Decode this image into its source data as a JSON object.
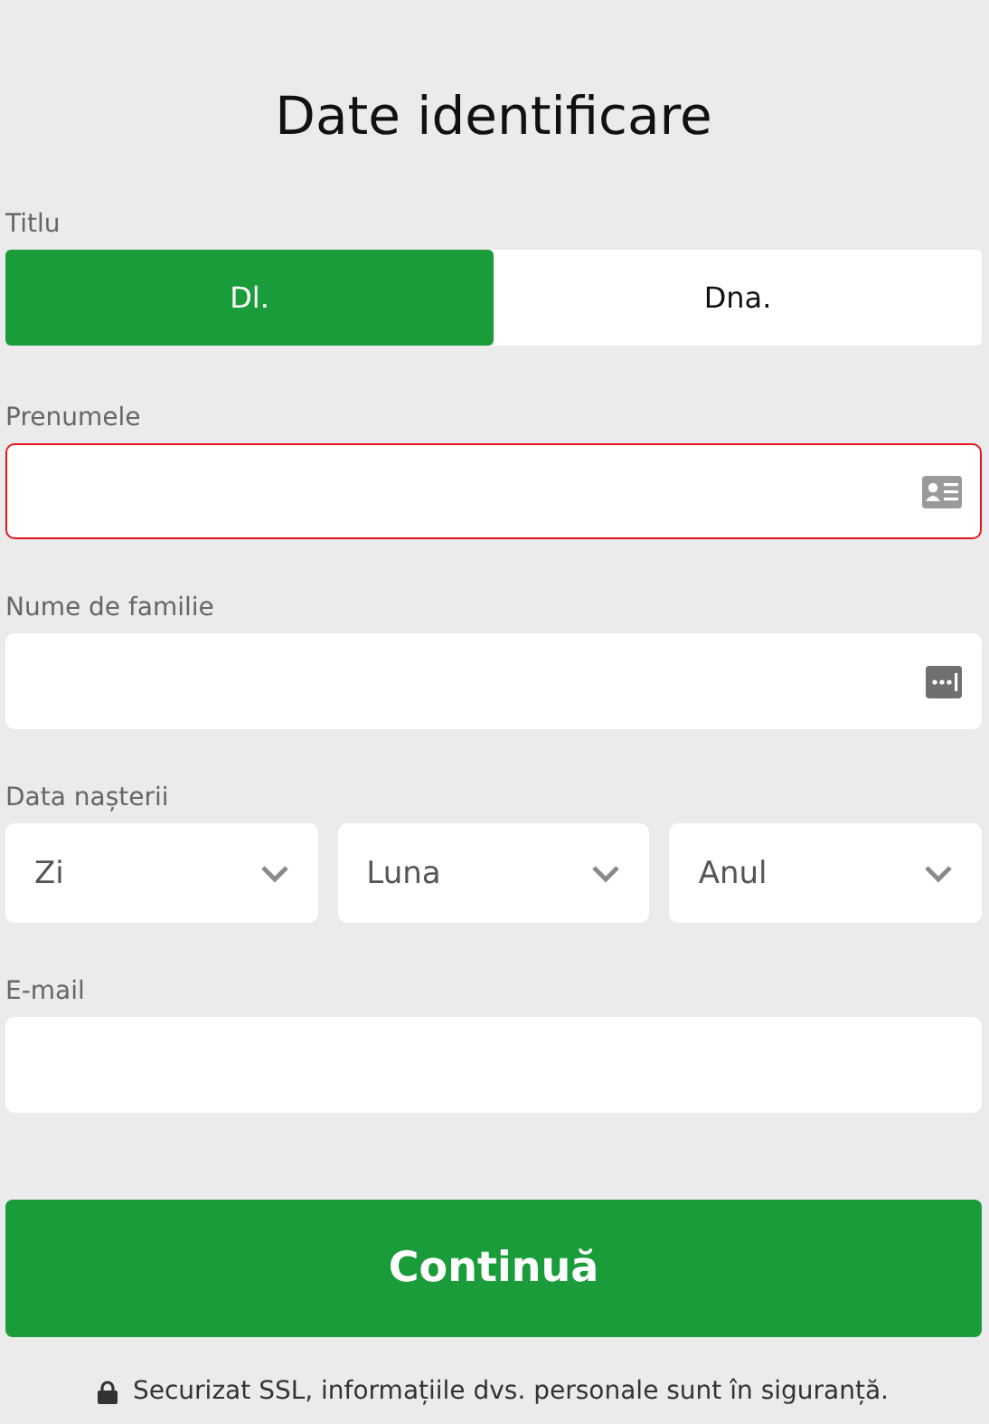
{
  "title": "Date identificare",
  "salutation": {
    "label": "Titlu",
    "options": [
      {
        "label": "Dl.",
        "selected": true
      },
      {
        "label": "Dna.",
        "selected": false
      }
    ]
  },
  "first_name": {
    "label": "Prenumele",
    "error": true
  },
  "last_name": {
    "label": "Nume de familie",
    "error": false
  },
  "birth_date": {
    "label": "Data nașterii",
    "selects": [
      {
        "placeholder": "Zi"
      },
      {
        "placeholder": "Luna"
      },
      {
        "placeholder": "Anul"
      }
    ]
  },
  "email": {
    "label": "E-mail",
    "error": false
  },
  "submit": "Continuă",
  "footer": "Securizat SSL, informațiile dvs. personale sunt în siguranță."
}
